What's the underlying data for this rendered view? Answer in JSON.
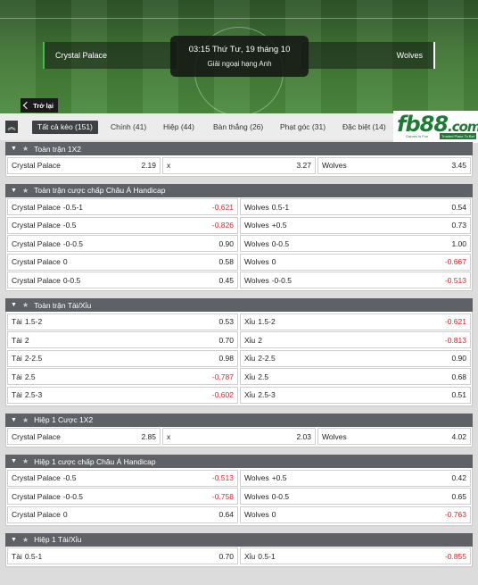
{
  "match": {
    "time": "03:15 Thứ Tư, 19 tháng 10",
    "league": "Giải ngoại hạng Anh",
    "home": "Crystal Palace",
    "away": "Wolves"
  },
  "back_label": "Trở lại",
  "logo": {
    "text": "fb88",
    "suffix": ".com",
    "tag1": "Games Is Fun",
    "tag2": "Trusted Place To Bet"
  },
  "tabs": [
    {
      "label": "Tất cả kèo (151)"
    },
    {
      "label": "Chính (41)"
    },
    {
      "label": "Hiệp (44)"
    },
    {
      "label": "Bàn thắng (26)"
    },
    {
      "label": "Phạt góc (31)"
    },
    {
      "label": "Đặc biệt (14)"
    }
  ],
  "colors": {
    "negative": "#e0232e",
    "section_header": "#5e6166",
    "active_tab": "#3d4246",
    "brand_green": "#1e7a34"
  },
  "sections": [
    {
      "title": "Toàn trận 1X2",
      "rows": [
        [
          {
            "name": "Crystal Palace",
            "hc": "",
            "odds": "2.19"
          },
          {
            "name": "x",
            "hc": "",
            "odds": "3.27"
          },
          {
            "name": "Wolves",
            "hc": "",
            "odds": "3.45"
          }
        ]
      ]
    },
    {
      "title": "Toàn trận cược chấp Châu Á Handicap",
      "rows": [
        [
          {
            "name": "Crystal Palace",
            "hc": "-0.5-1",
            "odds": "-0.621"
          },
          {
            "name": "Wolves",
            "hc": "0.5-1",
            "odds": "0.54"
          }
        ],
        [
          {
            "name": "Crystal Palace",
            "hc": "-0.5",
            "odds": "-0.826"
          },
          {
            "name": "Wolves",
            "hc": "+0.5",
            "odds": "0.73"
          }
        ],
        [
          {
            "name": "Crystal Palace",
            "hc": "-0-0.5",
            "odds": "0.90"
          },
          {
            "name": "Wolves",
            "hc": "0-0.5",
            "odds": "1.00"
          }
        ],
        [
          {
            "name": "Crystal Palace",
            "hc": "0",
            "odds": "0.58"
          },
          {
            "name": "Wolves",
            "hc": "0",
            "odds": "-0.667"
          }
        ],
        [
          {
            "name": "Crystal Palace",
            "hc": "0-0.5",
            "odds": "0.45"
          },
          {
            "name": "Wolves",
            "hc": "-0-0.5",
            "odds": "-0.513"
          }
        ]
      ]
    },
    {
      "title": "Toàn trận Tài/Xỉu",
      "rows": [
        [
          {
            "name": "Tài",
            "hc": "1.5-2",
            "odds": "0.53"
          },
          {
            "name": "Xỉu",
            "hc": "1.5-2",
            "odds": "-0.621"
          }
        ],
        [
          {
            "name": "Tài",
            "hc": "2",
            "odds": "0.70"
          },
          {
            "name": "Xỉu",
            "hc": "2",
            "odds": "-0.813"
          }
        ],
        [
          {
            "name": "Tài",
            "hc": "2-2.5",
            "odds": "0.98"
          },
          {
            "name": "Xỉu",
            "hc": "2-2.5",
            "odds": "0.90"
          }
        ],
        [
          {
            "name": "Tài",
            "hc": "2.5",
            "odds": "-0.787"
          },
          {
            "name": "Xỉu",
            "hc": "2.5",
            "odds": "0.68"
          }
        ],
        [
          {
            "name": "Tài",
            "hc": "2.5-3",
            "odds": "-0.602"
          },
          {
            "name": "Xỉu",
            "hc": "2.5-3",
            "odds": "0.51"
          }
        ]
      ]
    },
    {
      "title": "Hiệp 1 Cược 1X2",
      "rows": [
        [
          {
            "name": "Crystal Palace",
            "hc": "",
            "odds": "2.85"
          },
          {
            "name": "x",
            "hc": "",
            "odds": "2.03"
          },
          {
            "name": "Wolves",
            "hc": "",
            "odds": "4.02"
          }
        ]
      ]
    },
    {
      "title": "Hiệp 1 cược chấp Châu Á Handicap",
      "rows": [
        [
          {
            "name": "Crystal Palace",
            "hc": "-0.5",
            "odds": "-0.513"
          },
          {
            "name": "Wolves",
            "hc": "+0.5",
            "odds": "0.42"
          }
        ],
        [
          {
            "name": "Crystal Palace",
            "hc": "-0-0.5",
            "odds": "-0.758"
          },
          {
            "name": "Wolves",
            "hc": "0-0.5",
            "odds": "0.65"
          }
        ],
        [
          {
            "name": "Crystal Palace",
            "hc": "0",
            "odds": "0.64"
          },
          {
            "name": "Wolves",
            "hc": "0",
            "odds": "-0.763"
          }
        ]
      ]
    },
    {
      "title": "Hiệp 1 Tài/Xỉu",
      "rows": [
        [
          {
            "name": "Tài",
            "hc": "0.5-1",
            "odds": "0.70"
          },
          {
            "name": "Xỉu",
            "hc": "0.5-1",
            "odds": "-0.855"
          }
        ]
      ]
    }
  ]
}
